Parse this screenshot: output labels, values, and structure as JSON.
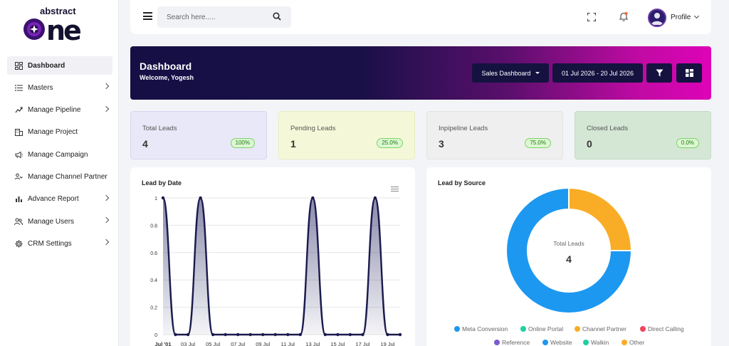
{
  "brand": {
    "small": "abstract",
    "big": "one"
  },
  "sidebar": {
    "items": [
      {
        "label": "Dashboard",
        "icon": "dashboard-icon",
        "active": true,
        "chevron": false
      },
      {
        "label": "Masters",
        "icon": "list-icon",
        "active": false,
        "chevron": true
      },
      {
        "label": "Manage Pipeline",
        "icon": "pipeline-icon",
        "active": false,
        "chevron": true
      },
      {
        "label": "Manage Project",
        "icon": "building-icon",
        "active": false,
        "chevron": false
      },
      {
        "label": "Manage Campaign",
        "icon": "megaphone-icon",
        "active": false,
        "chevron": false
      },
      {
        "label": "Manage Channel Partner",
        "icon": "partner-icon",
        "active": false,
        "chevron": false
      },
      {
        "label": "Advance Report",
        "icon": "bar-chart-icon",
        "active": false,
        "chevron": true
      },
      {
        "label": "Manage Users",
        "icon": "users-icon",
        "active": false,
        "chevron": true
      },
      {
        "label": "CRM Settings",
        "icon": "gear-icon",
        "active": false,
        "chevron": true
      }
    ]
  },
  "header": {
    "search_placeholder": "Search here.....",
    "profile_label": "Profile"
  },
  "banner": {
    "title": "Dashboard",
    "welcome": "Welcome, Yogesh",
    "dashboard_select": "Sales Dashboard",
    "date_range": "01 Jul 2026 - 20 Jul 2026"
  },
  "stats": [
    {
      "label": "Total Leads",
      "value": "4",
      "badge": "100%",
      "bg": "#e8e8f8",
      "border": "#d6d6f0"
    },
    {
      "label": "Pending Leads",
      "value": "1",
      "badge": "25.0%",
      "bg": "#f5f8d8",
      "border": "#e8edc0"
    },
    {
      "label": "Inpipeline Leads",
      "value": "3",
      "badge": "75.0%",
      "bg": "#efefef",
      "border": "#e3e3e3"
    },
    {
      "label": "Closed Leads",
      "value": "0",
      "badge": "0.0%",
      "bg": "#d4e7d5",
      "border": "#c3dcc4"
    }
  ],
  "lead_by_date": {
    "title": "Lead by Date"
  },
  "lead_by_source": {
    "title": "Lead by Source",
    "center_label": "Total Leads",
    "center_value": "4"
  },
  "chart_data": [
    {
      "type": "area",
      "title": "Lead by Date",
      "x": [
        "Jul '01",
        "02 Jul",
        "03 Jul",
        "04 Jul",
        "05 Jul",
        "06 Jul",
        "07 Jul",
        "08 Jul",
        "09 Jul",
        "10 Jul",
        "11 Jul",
        "12 Jul",
        "13 Jul",
        "14 Jul",
        "15 Jul",
        "16 Jul",
        "17 Jul",
        "18 Jul",
        "19 Jul",
        "20 Jul"
      ],
      "x_tick_labels": [
        "Jul '01",
        "03 Jul",
        "05 Jul",
        "07 Jul",
        "09 Jul",
        "11 Jul",
        "13 Jul",
        "15 Jul",
        "17 Jul",
        "19 Jul"
      ],
      "values": [
        1,
        0,
        0,
        1,
        0,
        0,
        0,
        0,
        0,
        0,
        0,
        0,
        1,
        0,
        0,
        0,
        0,
        1,
        0,
        0
      ],
      "ylim": [
        0,
        1
      ],
      "yticks": [
        "0",
        "0.2",
        "0.4",
        "0.6",
        "0.8",
        "1"
      ],
      "line_color": "#1a1a4e",
      "grid": true
    },
    {
      "type": "pie",
      "title": "Lead by Source",
      "categories": [
        "Meta Conversion",
        "Online Portal",
        "Channel Partner",
        "Direct Calling",
        "Reference",
        "Website",
        "Walkin",
        "Other"
      ],
      "values": [
        0,
        0,
        1,
        0,
        0,
        3,
        0,
        0
      ],
      "colors": [
        "#1d98f0",
        "#1dd1a1",
        "#f9ad26",
        "#f0455a",
        "#7a5ccf",
        "#1d98f0",
        "#1dd1a1",
        "#f9ad26"
      ],
      "legend": "bottom"
    }
  ]
}
